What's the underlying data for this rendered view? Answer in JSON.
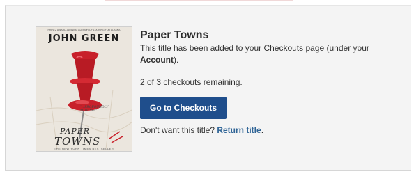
{
  "book": {
    "title": "Paper Towns",
    "cover": {
      "author": "JOHN GREEN",
      "tagline": "PRINTZ AWARD-WINNING AUTHOR OF LOOKING FOR ALASKA",
      "quote": "\"...PROFOUNDLY MOVING.\"",
      "title_top": "PAPER",
      "title_bottom": "TOWNS",
      "bestseller": "THE NEW YORK TIMES BESTSELLER"
    }
  },
  "message": {
    "before": "This title has been added to your Checkouts page (under your ",
    "account_link": "Account",
    "after": ")."
  },
  "checkouts_remaining": "2 of 3 checkouts remaining.",
  "go_button_label": "Go to Checkouts",
  "return_prompt": {
    "text": "Don't want this title? ",
    "link": "Return title",
    "suffix": "."
  },
  "colors": {
    "button": "#1f4e8c",
    "link": "#2f6496",
    "pin": "#c8202a",
    "panel_bg": "#f4f4f4"
  },
  "icons": {
    "cover_art": "red-push-pin"
  }
}
